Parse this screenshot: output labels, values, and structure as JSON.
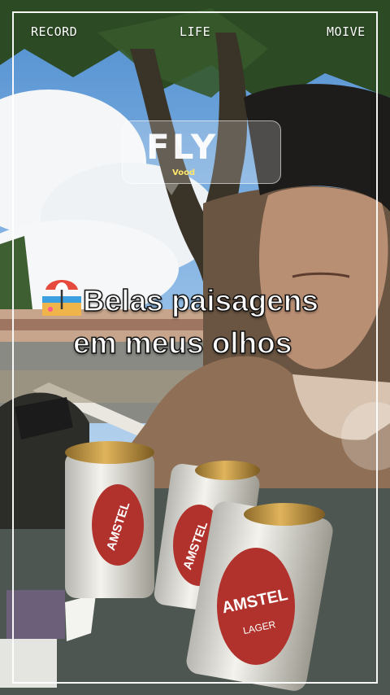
{
  "top_tags": {
    "record": "RECORD",
    "life": "LIFE",
    "movie": "MOIVE"
  },
  "sticker": {
    "big": "FLY",
    "small": "Vood"
  },
  "caption": {
    "line1": "Belas paisagens",
    "line2": "em meus olhos",
    "emoji": "beach-umbrella-icon"
  },
  "cans": [
    {
      "brand": "AMSTEL"
    },
    {
      "brand": "AMSTEL"
    },
    {
      "brand": "AMSTEL",
      "sub": "LAGER"
    }
  ]
}
